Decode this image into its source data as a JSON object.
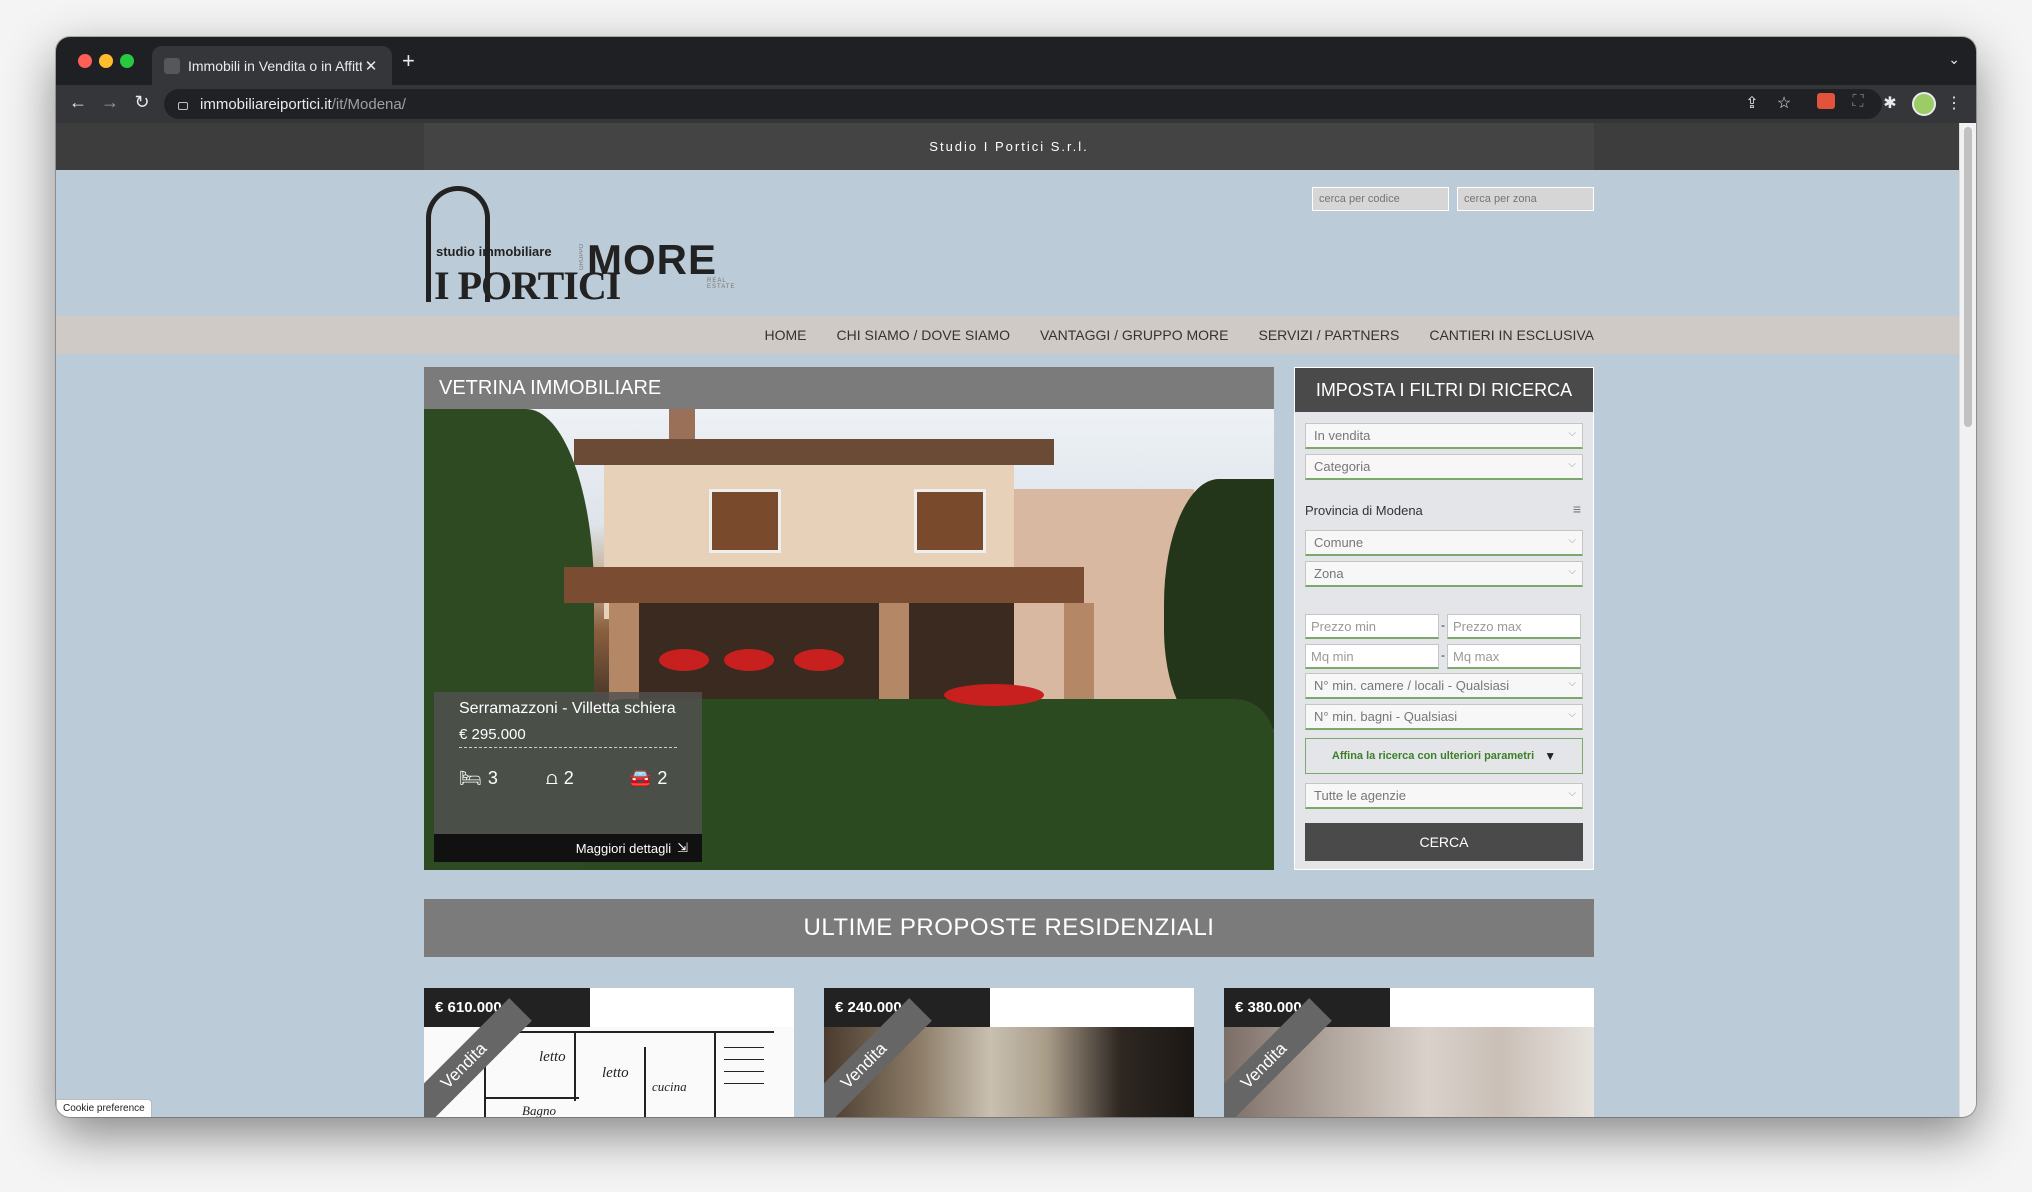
{
  "browser": {
    "tab_title": "Immobili in Vendita o in Affitto",
    "url_host": "immobiliareiportici.it",
    "url_path": "/it/Modena/"
  },
  "site": {
    "company": "Studio I Portici S.r.l.",
    "search_code_placeholder": "cerca per codice",
    "search_zone_placeholder": "cerca per zona",
    "logo_studio": "studio immobiliare",
    "logo_name": "I PORTICI",
    "logo_more": "MORE",
    "logo_gruppo": "GRUPPO",
    "logo_real_estate": "REAL ESTATE",
    "nav": [
      "HOME",
      "CHI SIAMO / DOVE SIAMO",
      "VANTAGGI / GRUPPO MORE",
      "SERVIZI / PARTNERS",
      "CANTIERI IN ESCLUSIVA"
    ]
  },
  "vetrina": {
    "title": "VETRINA IMMOBILIARE",
    "property_title": "Serramazzoni - Villetta schiera",
    "price": "€ 295.000",
    "beds": "3",
    "baths": "2",
    "parking": "2",
    "more_label": "Maggiori dettagli"
  },
  "filters": {
    "title": "IMPOSTA I FILTRI DI RICERCA",
    "contract": "In vendita",
    "category": "Categoria",
    "province": "Provincia di Modena",
    "comune": "Comune",
    "zona": "Zona",
    "price_min": "Prezzo min",
    "price_max": "Prezzo max",
    "mq_min": "Mq min",
    "mq_max": "Mq max",
    "rooms": "N° min. camere / locali - Qualsiasi",
    "baths": "N° min. bagni - Qualsiasi",
    "refine": "Affina la ricerca con ulteriori parametri",
    "agencies": "Tutte le agenzie",
    "search_button": "CERCA"
  },
  "latest": {
    "title": "ULTIME PROPOSTE RESIDENZIALI",
    "cards": [
      {
        "price": "€ 610.000",
        "badge": "Vendita",
        "plan_labels": [
          "letto",
          "letto",
          "cucina",
          "Bagno"
        ]
      },
      {
        "price": "€ 240.000",
        "badge": "Vendita"
      },
      {
        "price": "€ 380.000",
        "badge": "Vendita"
      }
    ]
  },
  "cookie_label": "Cookie preference"
}
